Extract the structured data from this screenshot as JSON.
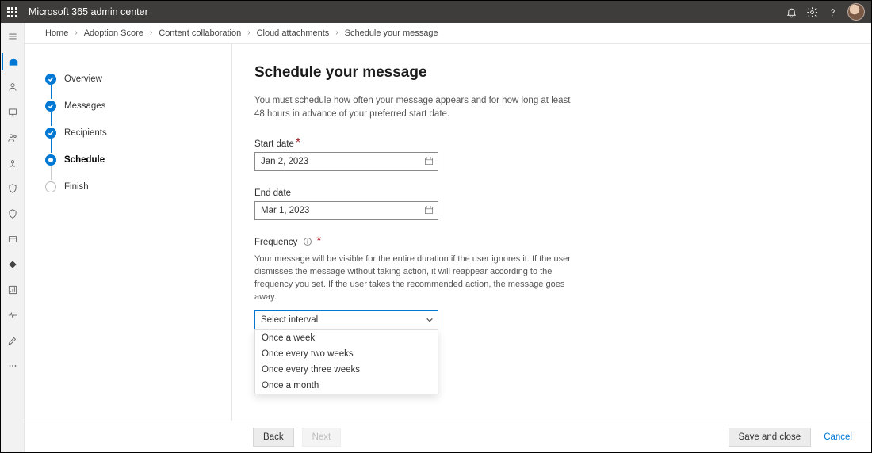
{
  "topbar": {
    "title": "Microsoft 365 admin center"
  },
  "breadcrumbs": [
    "Home",
    "Adoption Score",
    "Content collaboration",
    "Cloud attachments",
    "Schedule your message"
  ],
  "steps": [
    {
      "label": "Overview",
      "state": "done"
    },
    {
      "label": "Messages",
      "state": "done"
    },
    {
      "label": "Recipients",
      "state": "done"
    },
    {
      "label": "Schedule",
      "state": "current"
    },
    {
      "label": "Finish",
      "state": "pending"
    }
  ],
  "page": {
    "title": "Schedule your message",
    "description": "You must schedule how often your message appears and for how long at least 48 hours in advance of your preferred start date."
  },
  "form": {
    "start_date": {
      "label": "Start date",
      "value": "Jan 2, 2023",
      "required": true
    },
    "end_date": {
      "label": "End date",
      "value": "Mar 1, 2023",
      "required": false
    },
    "frequency": {
      "label": "Frequency",
      "required": true,
      "help": "Your message will be visible for the entire duration if the user ignores it. If the user dismisses the message without taking action, it will reappear according to the frequency you set. If the user takes the recommended action, the message goes away.",
      "placeholder": "Select interval",
      "options": [
        "Once a week",
        "Once every two weeks",
        "Once every three weeks",
        "Once a month"
      ]
    }
  },
  "footer": {
    "back": "Back",
    "next": "Next",
    "save": "Save and close",
    "cancel": "Cancel"
  }
}
